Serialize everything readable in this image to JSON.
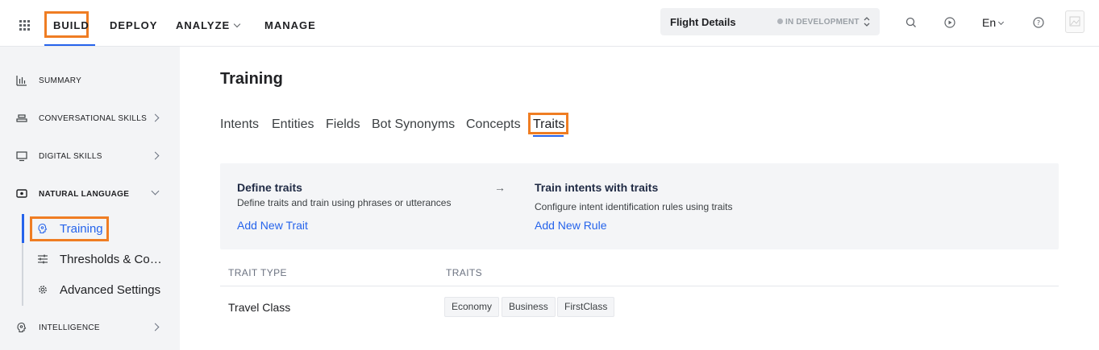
{
  "topnav": {
    "items": [
      "BUILD",
      "DEPLOY",
      "ANALYZE",
      "MANAGE"
    ],
    "active": "BUILD"
  },
  "app": {
    "name": "Flight Details",
    "status": "IN DEVELOPMENT"
  },
  "header": {
    "language": "En"
  },
  "sidebar": {
    "items": [
      {
        "label": "SUMMARY",
        "icon": "bar-chart-icon"
      },
      {
        "label": "CONVERSATIONAL SKILLS",
        "icon": "stack-icon"
      },
      {
        "label": "DIGITAL SKILLS",
        "icon": "monitor-icon"
      },
      {
        "label": "NATURAL LANGUAGE",
        "icon": "chat-bubble-icon"
      },
      {
        "label": "INTELLIGENCE",
        "icon": "brain-icon"
      }
    ],
    "subitems": [
      {
        "label": "Training",
        "icon": "brain-icon"
      },
      {
        "label": "Thresholds & Con...",
        "icon": "sliders-icon"
      },
      {
        "label": "Advanced Settings",
        "icon": "gear-icon"
      }
    ]
  },
  "main": {
    "title": "Training",
    "tabs": [
      "Intents",
      "Entities",
      "Fields",
      "Bot Synonyms",
      "Concepts",
      "Traits"
    ],
    "active_tab": "Traits",
    "card": {
      "left_title": "Define traits",
      "left_desc": "Define traits and train using phrases or utterances",
      "left_link": "Add New Trait",
      "arrow": "→",
      "right_title": "Train intents with traits",
      "right_desc": "Configure intent identification rules using traits",
      "right_link": "Add New Rule"
    },
    "table": {
      "headers": [
        "TRAIT TYPE",
        "TRAITS"
      ],
      "rows": [
        {
          "trait_type": "Travel Class",
          "traits": [
            "Economy",
            "Business",
            "FirstClass"
          ]
        }
      ]
    }
  },
  "colors": {
    "accent": "#2563eb",
    "highlight": "#ef7d23",
    "sidebar_bg": "#f3f4f6"
  }
}
